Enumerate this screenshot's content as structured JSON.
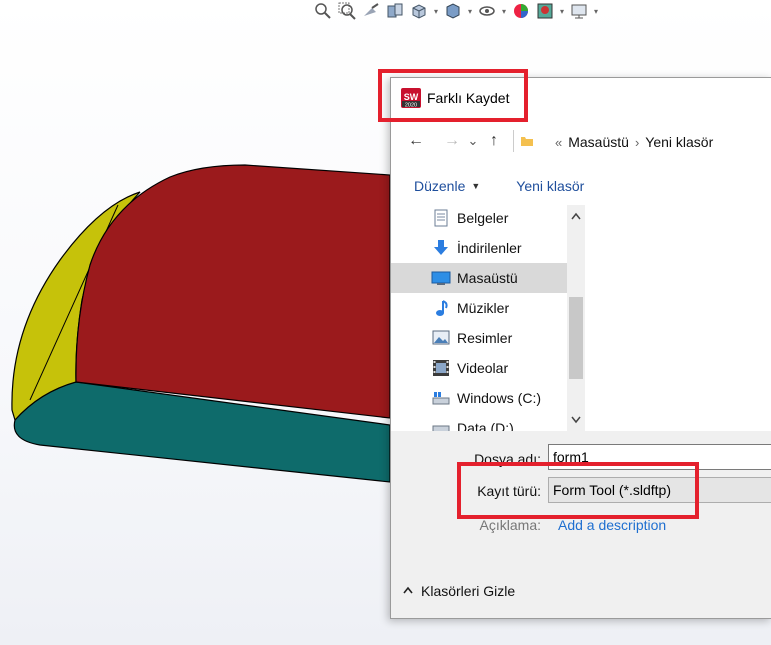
{
  "app": {
    "toolbar_icons": [
      "zoom-to-fit-icon",
      "zoom-area-icon",
      "previous-view-icon",
      "section-view-icon",
      "view-orientation-icon",
      "display-style-icon",
      "hide-show-icon",
      "edit-appearance-icon",
      "apply-scene-icon",
      "view-settings-icon"
    ]
  },
  "dialog": {
    "title": "Farklı Kaydet",
    "logo_text": "SW",
    "logo_year": "2020",
    "nav": {
      "back": "←",
      "forward": "→",
      "recent": "⌄",
      "up": "↑"
    },
    "breadcrumb": {
      "prefix": "«",
      "segments": [
        "Masaüstü",
        "Yeni klasör"
      ],
      "separator": "›"
    },
    "commands": {
      "organize": "Düzenle",
      "new_folder": "Yeni klasör"
    },
    "tree": [
      {
        "label": "Belgeler",
        "icon": "documents-icon"
      },
      {
        "label": "İndirilenler",
        "icon": "downloads-icon"
      },
      {
        "label": "Masaüstü",
        "icon": "desktop-icon",
        "selected": true
      },
      {
        "label": "Müzikler",
        "icon": "music-icon"
      },
      {
        "label": "Resimler",
        "icon": "pictures-icon"
      },
      {
        "label": "Videolar",
        "icon": "videos-icon"
      },
      {
        "label": "Windows (C:)",
        "icon": "drive-icon"
      },
      {
        "label": "Data (D:)",
        "icon": "drive-icon"
      }
    ],
    "filename_label": "Dosya adı:",
    "filename_value": "form1",
    "filetype_label": "Kayıt türü:",
    "filetype_value": "Form Tool (*.sldftp)",
    "description_label": "Açıklama:",
    "description_link": "Add a description",
    "hide_folders": "Klasörleri Gizle"
  },
  "colors": {
    "highlight": "#e4202d",
    "model_red": "#9b1a1c",
    "model_yellow": "#c6c20a",
    "model_teal": "#0e6b6b",
    "link": "#1e6fd0"
  }
}
